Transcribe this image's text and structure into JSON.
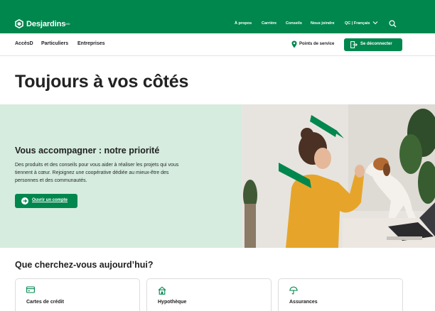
{
  "header": {
    "brand": "Desjardins",
    "brand_mark": "MD",
    "nav": [
      "À propos",
      "Carrière",
      "Conseils",
      "Nous joindre",
      "QC | Français"
    ],
    "icons": [
      "desjardins-hexagon-icon",
      "chevron-down-icon",
      "search-icon"
    ]
  },
  "subnav": {
    "links": [
      "AccèsD",
      "Particuliers",
      "Entreprises"
    ],
    "points_label": "Points de service",
    "logout_label": "Se déconnecter",
    "icons": [
      "map-pin-icon",
      "logout-icon"
    ]
  },
  "main": {
    "headline": "Toujours à vos côtés"
  },
  "hero": {
    "title": "Vous accompagner : notre priorité",
    "description": "Des produits et des conseils pour vous aider à réaliser les projets qui vous tiennent à cœur. Rejoignez une coopérative dédiée au mieux-être des personnes et des communautés.",
    "cta_label": "Ouvrir un compte",
    "cta_icon": "arrow-right-circle-icon",
    "photo_icon": "woman-high-five-dog-photo"
  },
  "search_section": {
    "title": "Que cherchez-vous aujourd’hui?",
    "cards": [
      {
        "label": "Cartes de crédit",
        "icon": "credit-card-icon"
      },
      {
        "label": "Hypothèque",
        "icon": "house-icon"
      },
      {
        "label": "Assurances",
        "icon": "umbrella-icon"
      }
    ]
  },
  "colors": {
    "brand_green": "#00874e",
    "hero_mint": "#d5ecdf",
    "text": "#1f1f1f"
  }
}
